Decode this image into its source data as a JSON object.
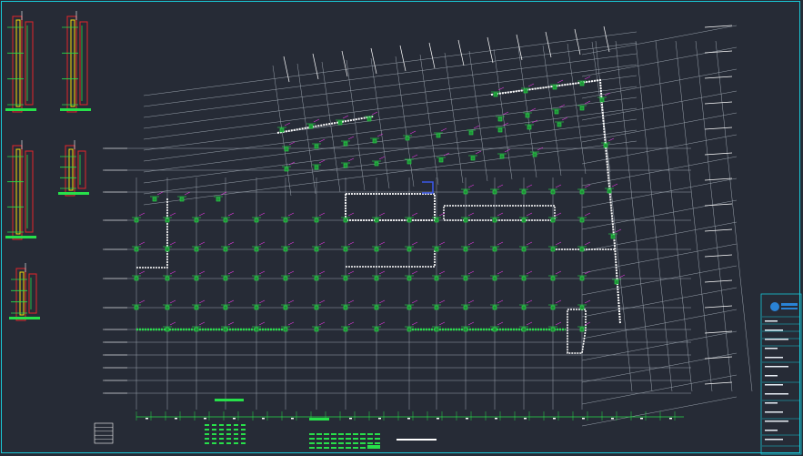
{
  "drawing": {
    "type": "structural floor plan (CAD)",
    "sheet_border_color": "#19c7d6",
    "background_color": "#262b36",
    "colors": {
      "grid": "#9aa3ad",
      "wall": "#ffffff",
      "rebar_green": "#27e04a",
      "rebar_magenta": "#e23be0",
      "detail_red": "#e4252b",
      "detail_yellow": "#f5d90a",
      "titleblock_cyan": "#19c7d6",
      "logo_blue": "#2a83d6"
    },
    "title_block": {
      "logo": "company-logo-icon"
    }
  }
}
